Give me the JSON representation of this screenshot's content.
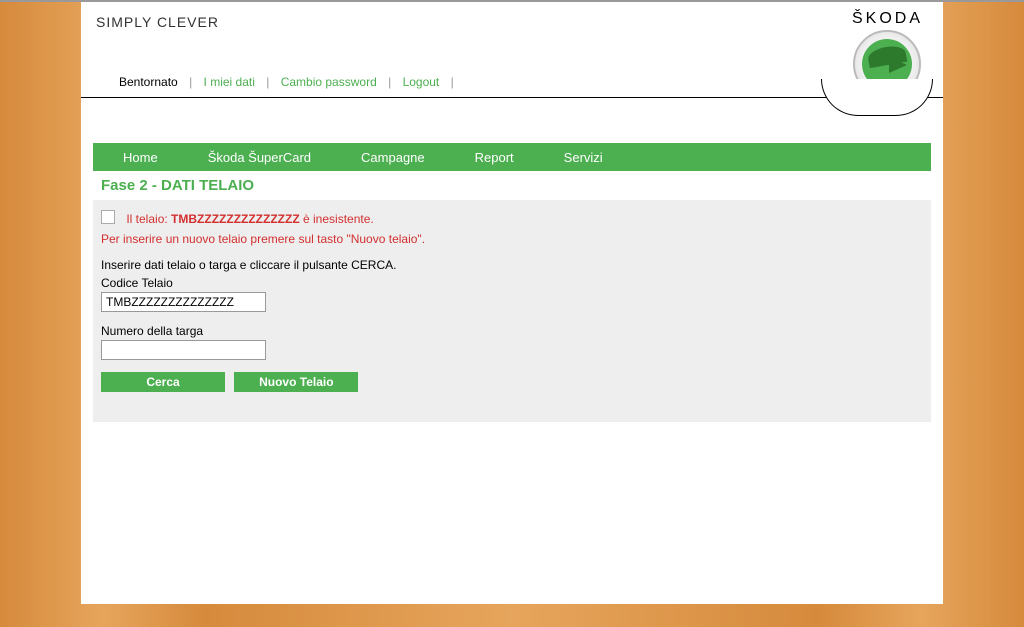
{
  "header": {
    "slogan": "SIMPLY CLEVER",
    "brand": "ŠKODA"
  },
  "top_nav": {
    "welcome": "Bentornato",
    "my_data": "I miei dati",
    "change_password": "Cambio password",
    "logout": "Logout"
  },
  "main_nav": {
    "home": "Home",
    "supercard": "Škoda ŠuperCard",
    "campagne": "Campagne",
    "report": "Report",
    "servizi": "Servizi"
  },
  "section": {
    "title": "Fase 2 - DATI TELAIO"
  },
  "error": {
    "prefix": "Il telaio: ",
    "vin": "TMBZZZZZZZZZZZZZZ",
    "suffix": " è inesistente.",
    "instruction": "Per inserire un nuovo telaio premere sul tasto \"Nuovo telaio\"."
  },
  "form": {
    "instruction": "Inserire dati telaio o targa e cliccare il pulsante CERCA.",
    "codice_label": "Codice Telaio",
    "codice_value": "TMBZZZZZZZZZZZZZZ",
    "targa_label": "Numero della targa",
    "targa_value": ""
  },
  "buttons": {
    "cerca": "Cerca",
    "nuovo": "Nuovo Telaio"
  }
}
